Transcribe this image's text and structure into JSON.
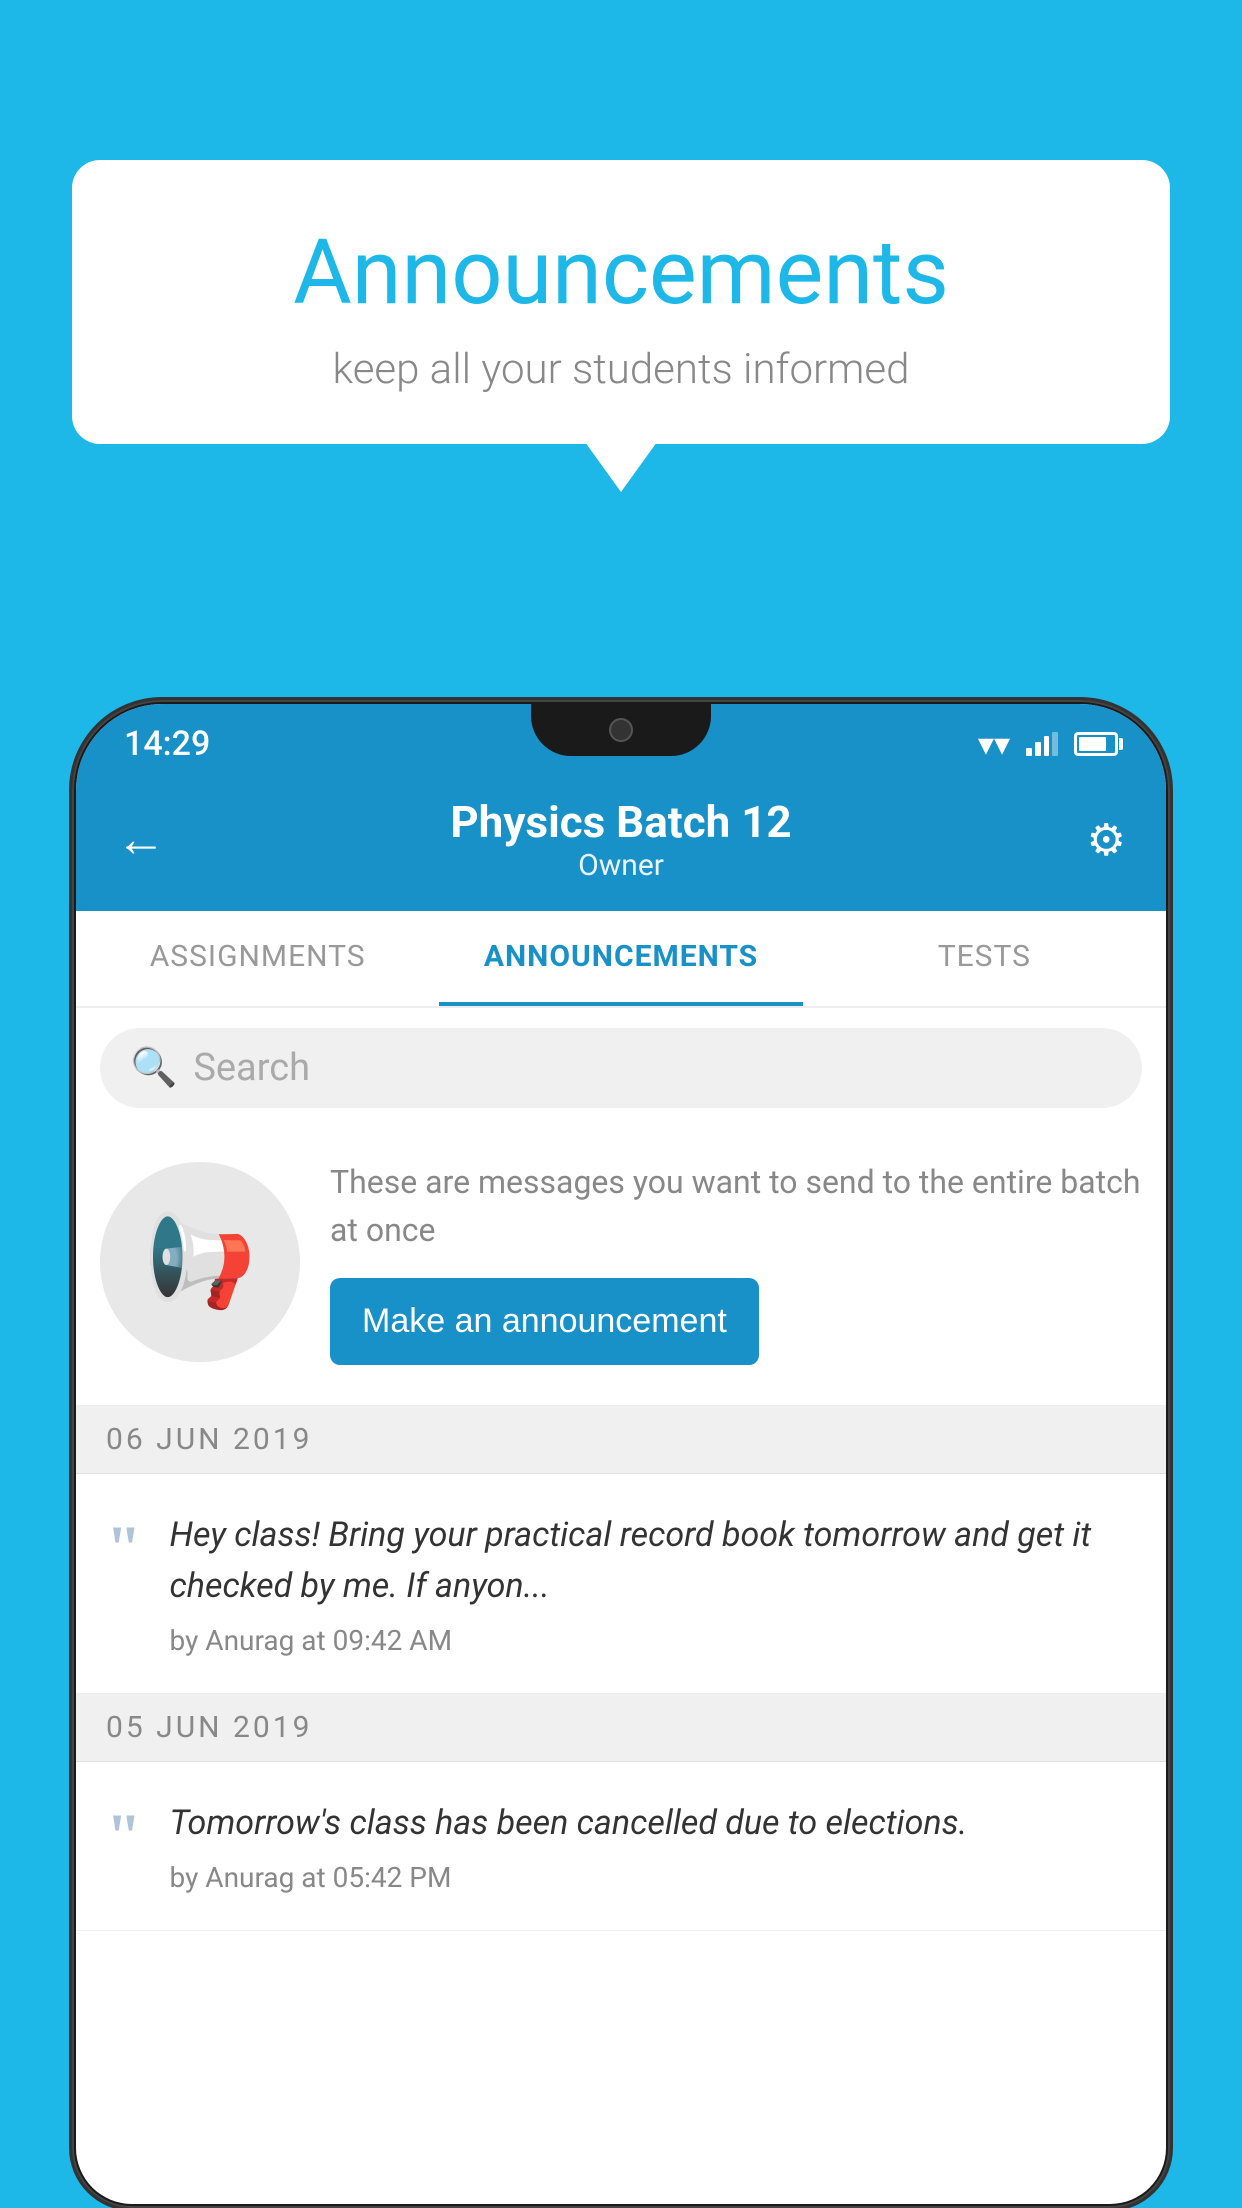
{
  "background_color": "#1DB8E8",
  "speech_bubble": {
    "title": "Announcements",
    "subtitle": "keep all your students informed"
  },
  "phone": {
    "status_bar": {
      "time": "14:29"
    },
    "header": {
      "title": "Physics Batch 12",
      "subtitle": "Owner",
      "back_label": "←",
      "settings_label": "⚙"
    },
    "tabs": [
      {
        "label": "ASSIGNMENTS",
        "active": false
      },
      {
        "label": "ANNOUNCEMENTS",
        "active": true
      },
      {
        "label": "TESTS",
        "active": false
      }
    ],
    "search": {
      "placeholder": "Search"
    },
    "cta_section": {
      "description_text": "These are messages you want to send to the entire batch at once",
      "button_label": "Make an announcement"
    },
    "announcements": [
      {
        "date": "06  JUN  2019",
        "text": "Hey class! Bring your practical record book tomorrow and get it checked by me. If anyon...",
        "meta": "by Anurag at 09:42 AM"
      },
      {
        "date": "05  JUN  2019",
        "text": "Tomorrow's class has been cancelled due to elections.",
        "meta": "by Anurag at 05:42 PM"
      }
    ]
  }
}
